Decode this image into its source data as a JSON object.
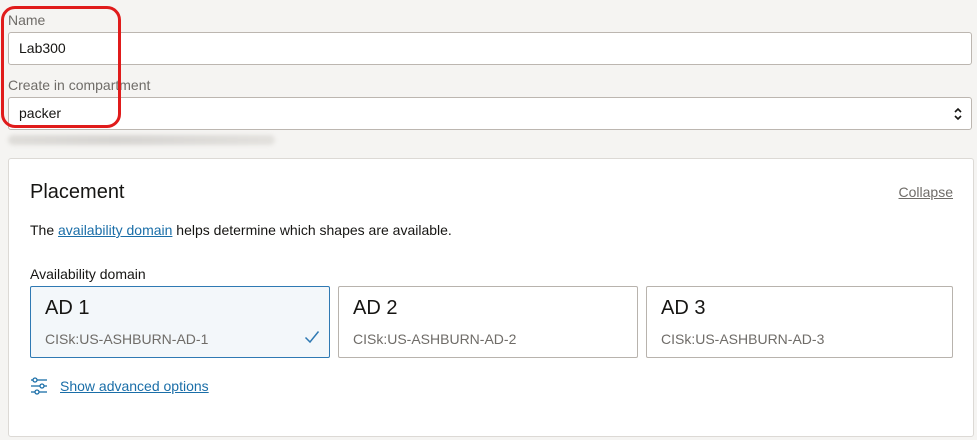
{
  "name_field": {
    "label": "Name",
    "value": "Lab300"
  },
  "compartment_field": {
    "label": "Create in compartment",
    "value": "packer"
  },
  "placement": {
    "title": "Placement",
    "collapse_label": "Collapse",
    "help_prefix": "The ",
    "help_link": "availability domain",
    "help_suffix": " helps determine which shapes are available.",
    "ad_label": "Availability domain",
    "domains": [
      {
        "name": "AD 1",
        "id": "CISk:US-ASHBURN-AD-1",
        "selected": true
      },
      {
        "name": "AD 2",
        "id": "CISk:US-ASHBURN-AD-2",
        "selected": false
      },
      {
        "name": "AD 3",
        "id": "CISk:US-ASHBURN-AD-3",
        "selected": false
      }
    ],
    "advanced_label": "Show advanced options"
  },
  "colors": {
    "accent": "#1a6ea8",
    "selected_border": "#2f79b3",
    "highlight": "#e01b1b"
  }
}
